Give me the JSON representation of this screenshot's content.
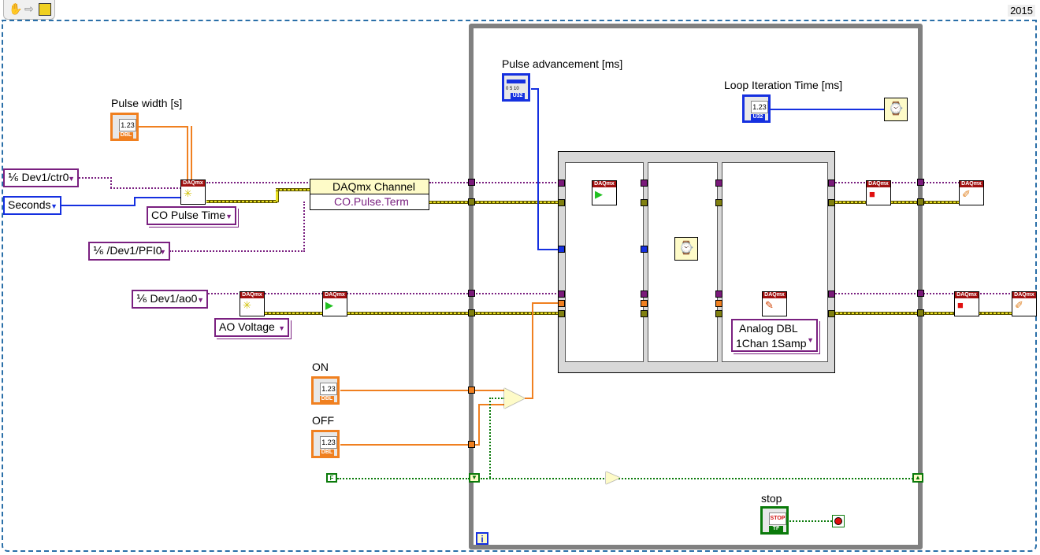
{
  "toolbar": {
    "icons": [
      "hand-icon",
      "arrow-right-icon",
      "vi-icon"
    ],
    "hand_glyph": "✋",
    "arrow_glyph": "⇨",
    "vi_glyph": "▶"
  },
  "version_label": "2015",
  "controls": {
    "pulse_width": {
      "label": "Pulse width [s]",
      "display": "1.23",
      "type": "DBL"
    },
    "pulse_advancement": {
      "label": "Pulse advancement [ms]",
      "type": "U32",
      "scale": "0 5 10"
    },
    "loop_iteration_time": {
      "label": "Loop Iteration Time [ms]",
      "display": "1.23",
      "type": "U32"
    },
    "on": {
      "label": "ON",
      "display": "1.23",
      "type": "DBL"
    },
    "off": {
      "label": "OFF",
      "display": "1.23",
      "type": "DBL"
    },
    "stop": {
      "label": "stop",
      "button_text": "STOP",
      "type": "TF"
    }
  },
  "constants": {
    "counter_channel": "Dev1/ctr0",
    "units": "Seconds",
    "pulse_terminal": "/Dev1/PFI0",
    "ao_channel": "Dev1/ao0",
    "channel_type_co": "CO Pulse Time",
    "channel_type_ao": "AO Voltage",
    "write_mode_line1": "Analog DBL",
    "write_mode_line2": "1Chan 1Samp",
    "false_const": "F",
    "io_prefix": "⅙"
  },
  "property_node": {
    "title": "DAQmx Channel",
    "property": "CO.Pulse.Term"
  },
  "daqmx": {
    "header": "DAQmx"
  },
  "loop": {
    "iteration_terminal": "i"
  },
  "colors": {
    "dbl": "#f08020",
    "u32": "#1530e0",
    "bool": "#0a7a0a",
    "task": "#7a2080",
    "error": "#e8e020",
    "frame": "#2a6fa8"
  }
}
